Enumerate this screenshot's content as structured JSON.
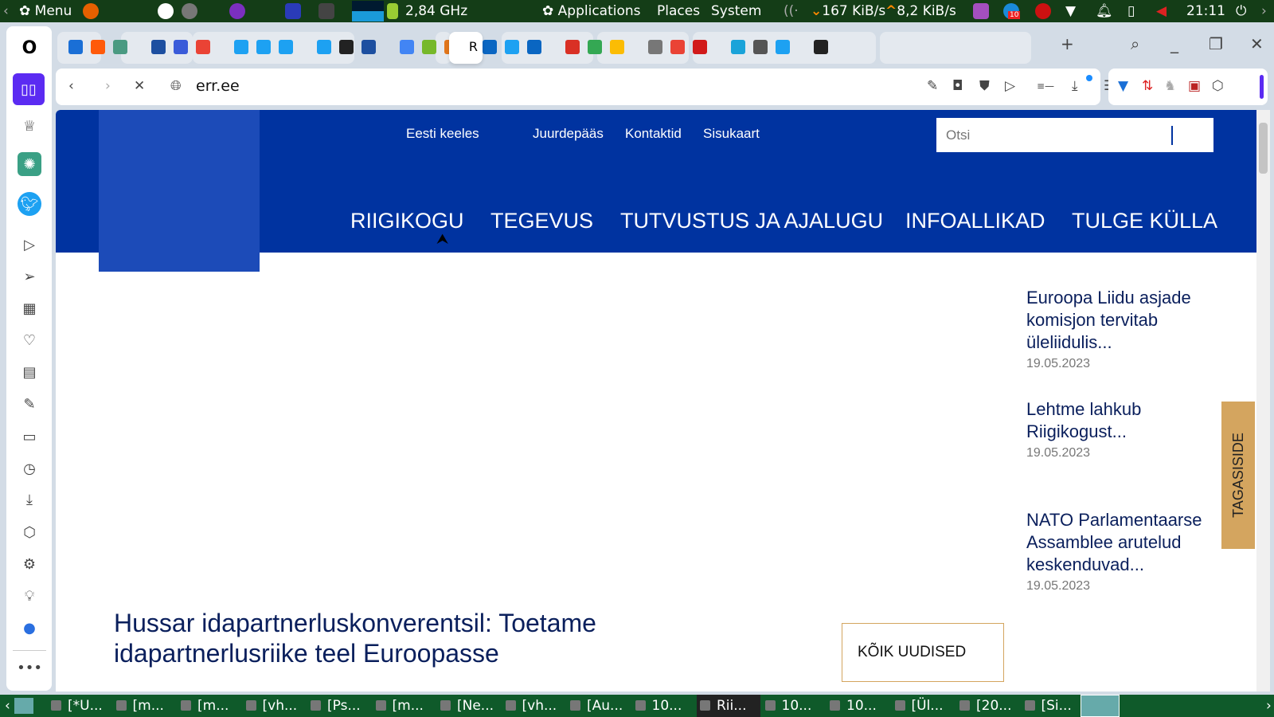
{
  "top_panel": {
    "menu_label": "Menu",
    "cpu_freq": "2,84 GHz",
    "applications": "Applications",
    "places": "Places",
    "system": "System",
    "net_down": "167 KiB/s",
    "net_up": "8,2 KiB/s",
    "clock": "21:11",
    "notification_badge": "10"
  },
  "browser": {
    "tabs": [
      {
        "icon": "filter-icon",
        "color": "#1a6fd6"
      },
      {
        "icon": "orange-square-icon",
        "color": "#ff5a0a"
      },
      {
        "icon": "chatgpt-icon",
        "color": "#4a9a82"
      },
      {
        "icon": "err-icon",
        "color": "#1d4fa0"
      },
      {
        "icon": "dd-icon",
        "color": "#3a5bd9"
      },
      {
        "icon": "google-icon",
        "color": "#ea4335"
      },
      {
        "icon": "twitter-icon",
        "color": "#1da1f2"
      },
      {
        "icon": "twitter-icon",
        "color": "#1da1f2"
      },
      {
        "icon": "twitter-icon",
        "color": "#1da1f2"
      },
      {
        "icon": "twitter-icon",
        "color": "#1da1f2"
      },
      {
        "icon": "wikipedia-icon",
        "color": "#222222"
      },
      {
        "icon": "err-icon",
        "color": "#1d4fa0"
      },
      {
        "icon": "google-icon",
        "color": "#4285f4"
      },
      {
        "icon": "ddg-icon",
        "color": "#76b82a"
      },
      {
        "icon": "metamask-icon",
        "color": "#e2761b"
      },
      {
        "icon": "linkedin-icon",
        "color": "#0a66c2"
      },
      {
        "icon": "twitter-icon",
        "color": "#1da1f2"
      },
      {
        "icon": "linkedin-icon",
        "color": "#0a66c2"
      },
      {
        "icon": "gmail-icon",
        "color": "#d93025"
      },
      {
        "icon": "google-drive-icon",
        "color": "#34a853"
      },
      {
        "icon": "google-drive-icon",
        "color": "#fbbc04"
      },
      {
        "icon": "file-icon",
        "color": "#777777"
      },
      {
        "icon": "google-icon",
        "color": "#ea4335"
      },
      {
        "icon": "pw-icon",
        "color": "#d11a1a"
      },
      {
        "icon": "ss-icon",
        "color": "#1aa3d9"
      },
      {
        "icon": "react-icon",
        "color": "#555555"
      },
      {
        "icon": "twitter-icon",
        "color": "#1da1f2"
      },
      {
        "icon": "speedtest-icon",
        "color": "#222222"
      }
    ],
    "active_tab_label": "R",
    "url": "err.ee"
  },
  "page": {
    "top_links": [
      "Eesti keeles",
      "Juurdepääs",
      "Kontaktid",
      "Sisukaart"
    ],
    "search_placeholder": "Otsi",
    "nav": [
      "RIIGIKOGU",
      "TEGEVUS",
      "TUTVUSTUS JA AJALUGU",
      "INFOALLIKAD",
      "TULGE KÜLLA"
    ],
    "news": [
      {
        "title": "Euroopa Liidu asjade komisjon tervitab üleliidulis...",
        "date": "19.05.2023"
      },
      {
        "title": "Lehtme lahkub Riigikogust...",
        "date": "19.05.2023"
      },
      {
        "title": "NATO Parlamentaarse Assamblee arutelud keskenduvad...",
        "date": "19.05.2023"
      }
    ],
    "feedback": "TAGASISIDE",
    "headline": "Hussar idapartnerluskonverentsil: Toetame idapartnerlusriike teel Euroopasse",
    "all_news": "KÕIK UUDISED"
  },
  "taskbar": [
    "[*U...",
    "[m...",
    "[m...",
    "[vh...",
    "[Ps...",
    "[m...",
    "[Ne...",
    "[vh...",
    "[Au...",
    "10...",
    "Rii...",
    "10...",
    "10...",
    "[Ül...",
    "[20...",
    "[Si..."
  ]
}
